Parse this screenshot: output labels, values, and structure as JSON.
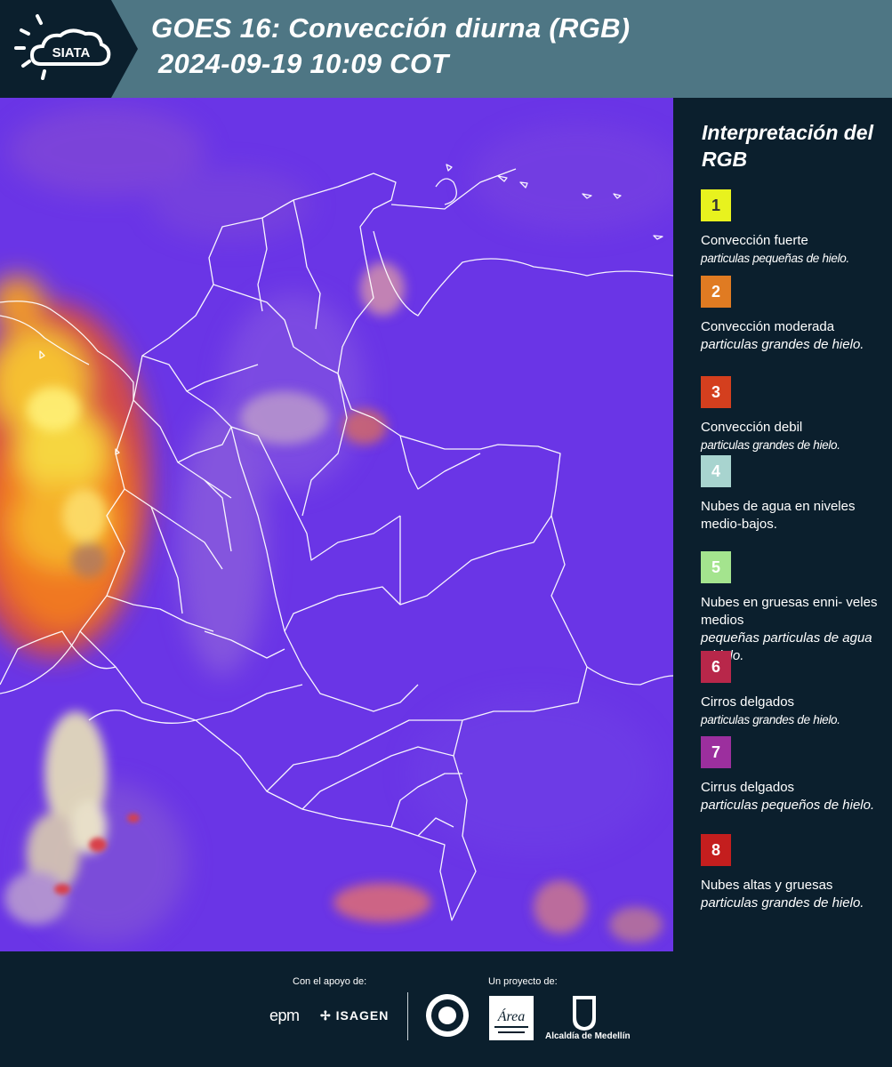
{
  "header": {
    "logo_text": "SIATA",
    "title_line1": "GOES 16: Convección diurna (RGB)",
    "title_line2": "2024-09-19 10:09 COT",
    "bg_color": "#4e7684",
    "logo_bg_color": "#0b1f2d"
  },
  "map": {
    "base_color": "#6a35e6",
    "boundary_color": "#ffffff"
  },
  "legend": {
    "title": "Interpretación del RGB",
    "items": [
      {
        "number": "1",
        "color": "#e8f21e",
        "number_color": "#333333",
        "name": "Convección fuerte",
        "desc": "particulas pequeñas de hielo."
      },
      {
        "number": "2",
        "color": "#e07b22",
        "number_color": "#ffffff",
        "name": "Convección moderada",
        "desc": "particulas grandes de hielo."
      },
      {
        "number": "3",
        "color": "#d43f1e",
        "number_color": "#ffffff",
        "name": "Convección debil",
        "desc": "particulas grandes de hielo."
      },
      {
        "number": "4",
        "color": "#a8d4cf",
        "number_color": "#ffffff",
        "name": "Nubes de agua en niveles medio-bajos.",
        "desc": ""
      },
      {
        "number": "5",
        "color": "#a4e48e",
        "number_color": "#ffffff",
        "name": "Nubes en gruesas enni- veles medios",
        "desc": "pequeñas particulas de agua o hielo."
      },
      {
        "number": "6",
        "color": "#b8274a",
        "number_color": "#ffffff",
        "name": "Cirros delgados",
        "desc": "particulas grandes de hielo."
      },
      {
        "number": "7",
        "color": "#9c2f9e",
        "number_color": "#ffffff",
        "name": "Cirrus delgados",
        "desc": "particulas pequeños de hielo."
      },
      {
        "number": "8",
        "color": "#c41e1e",
        "number_color": "#ffffff",
        "name": "Nubes altas y gruesas",
        "desc": "particulas grandes de hielo."
      }
    ]
  },
  "footer": {
    "support_label": "Con el apoyo de:",
    "project_label": "Un proyecto de:",
    "epm": "epm",
    "isagen": "ISAGEN",
    "alcaldia": "Alcaldía de Medellín"
  }
}
